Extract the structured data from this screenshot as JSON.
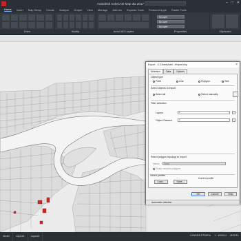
{
  "app": {
    "title": "Autodesk AutoCAD Map 3D 2017",
    "window_controls": [
      "–",
      "□",
      "✕"
    ]
  },
  "menu_tabs": [
    "Home",
    "Insert",
    "Map Setup",
    "Create",
    "Analyze",
    "Output",
    "View",
    "Manage",
    "Add-ins",
    "Express Tools",
    "Featured Apps",
    "Raster Tools"
  ],
  "ribbon": {
    "panels": [
      "Draw",
      "Modify",
      "AutoCAD Layers",
      "Properties",
      "Clipboard"
    ],
    "properties": {
      "row1": "ByLayer",
      "row2": "ByLayer",
      "row3": "ByLayer"
    }
  },
  "dialog": {
    "title": "Export - C:\\Users\\Adel...\\Export.shp",
    "tabs": [
      "Selection",
      "Data",
      "Options"
    ],
    "object_type_label": "Object type",
    "object_types": [
      "Point",
      "Line",
      "Polygon",
      "Text"
    ],
    "select_label": "Select objects to export",
    "select_all": "Select all",
    "select_manually": "Select manually",
    "filter_label": "Filter selection",
    "layers_label": "Layers:",
    "layers_value": "*",
    "object_classes_label": "Object Classes:",
    "object_classes_value": "*",
    "polygon_topology_label": "Select polygon topology to export",
    "name_label": "Name:",
    "name_value": "None",
    "group_complex_label": "Group complex polygons",
    "saved_profiles_label": "Saved profiles",
    "load_label": "Load...",
    "save_label": "Save...",
    "current_profile_label": "Current profile",
    "ok_label": "OK",
    "cancel_label": "Cancel",
    "help_label": "Help",
    "bottom_text": "Automatic selection"
  },
  "statusbar": {
    "tabs": [
      "Model",
      "Layout1",
      "Layout2"
    ],
    "right": [
      "CANADA-STANDA",
      "1 : 40000,0",
      "MODEL"
    ]
  }
}
